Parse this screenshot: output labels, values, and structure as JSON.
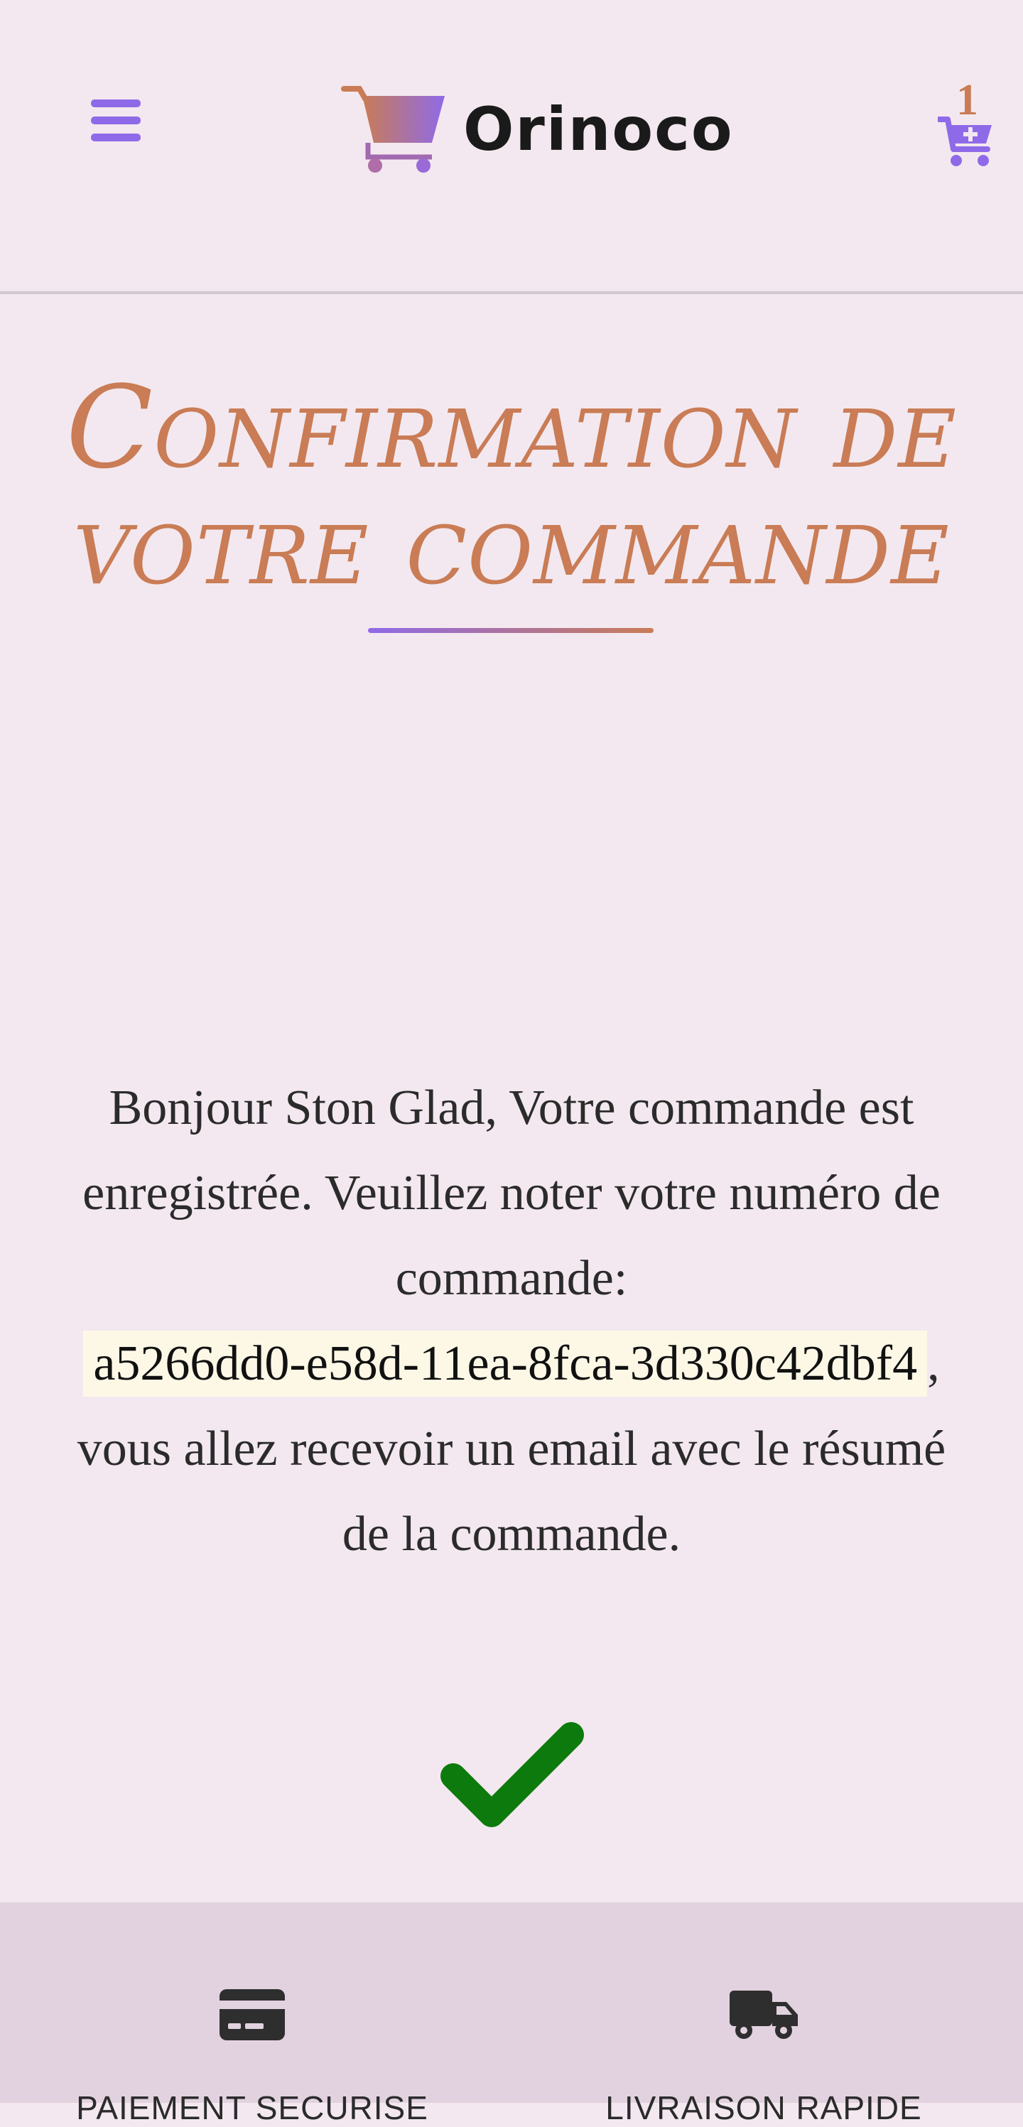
{
  "header": {
    "brand": "Orinoco",
    "menu_icon": "hamburger-menu-icon",
    "cart_icon": "cart-plus-icon",
    "cart_count": "1"
  },
  "page": {
    "title": "Confirmation de votre commande"
  },
  "confirmation": {
    "greeting": "Bonjour Ston Glad, Votre commande est enregistrée. Veuillez noter votre numéro de commande:",
    "order_number": "a5266dd0-e58d-11ea-8fca-3d330c42dbf4",
    "separator": ",",
    "closing": "vous allez recevoir un email avec le résumé de la commande.",
    "status_icon": "check-icon"
  },
  "footer": {
    "features": [
      {
        "label": "PAIEMENT SECURISE",
        "icon": "credit-card-icon"
      },
      {
        "label": "LIVRAISON RAPIDE",
        "icon": "delivery-truck-icon"
      }
    ]
  },
  "colors": {
    "background": "#f3e8ef",
    "accent_purple": "#8f6ae8",
    "accent_orange": "#c97c55",
    "success_green": "#0d7a0d",
    "footer_background": "#e2d2df",
    "order_highlight": "#fdf8e6"
  }
}
